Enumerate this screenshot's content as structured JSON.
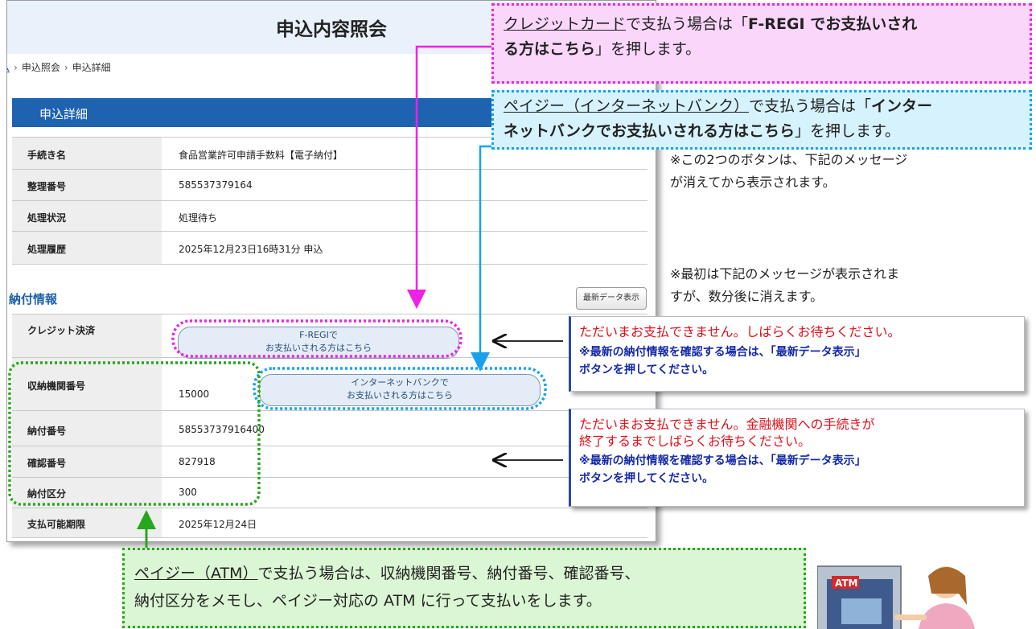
{
  "header": {
    "title": "申込内容照会"
  },
  "breadcrumb": {
    "home": "ム",
    "sep": "›",
    "items": [
      "申込照会",
      "申込詳細"
    ]
  },
  "section": {
    "title": "申込詳細"
  },
  "details": [
    {
      "label": "手続き名",
      "value": "食品営業許可申請手数料【電子納付】"
    },
    {
      "label": "整理番号",
      "value": "585537379164"
    },
    {
      "label": "処理状況",
      "value": "処理待ち"
    },
    {
      "label": "処理履歴",
      "value": "2025年12月23日16時31分 申込"
    }
  ],
  "payment": {
    "title": "納付情報",
    "latest_button": "最新データ表示",
    "credit_label": "クレジット決済",
    "fregi_button_line1": "F-REGIで",
    "fregi_button_line2": "お支払いされる方はこちら",
    "rows": [
      {
        "label": "収納機関番号",
        "value": "15000"
      },
      {
        "label": "納付番号",
        "value": "58553737916400"
      },
      {
        "label": "確認番号",
        "value": "827918"
      },
      {
        "label": "納付区分",
        "value": "300"
      },
      {
        "label": "支払可能期限",
        "value": "2025年12月24日"
      }
    ],
    "bank_button_line1": "インターネットバンクで",
    "bank_button_line2": "お支払いされる方はこちら"
  },
  "callouts": {
    "credit": {
      "u1": "クレジットカード",
      "t1": "で支払う場合は「",
      "b1": "F-REGI でお支払いされ",
      "b2": "る方はこちら",
      "t2": "」を押します。"
    },
    "bank": {
      "u1": "ペイジー（インターネットバンク）",
      "t1": "で支払う場合は「",
      "b1": "インター",
      "b2": "ネットバンクでお支払いされる方はこちら",
      "t2": "」を押します。"
    },
    "atm": {
      "u1": "ペイジー（ATM）",
      "t1": "で支払う場合は、収納機関番号、納付番号、確認番号、",
      "t2": "納付区分をメモし、ペイジー対応の ATM に行って支払いをします。"
    }
  },
  "notes": {
    "note1_line1": "※この2つのボタンは、下記のメッセージ",
    "note1_line2": "が消えてから表示されます。",
    "note2_line1": "※最初は下記のメッセージが表示されま",
    "note2_line2": "すが、数分後に消えます。"
  },
  "messages": {
    "msg1_red": "ただいまお支払できません。しばらくお待ちください。",
    "msg1_blue1": "※最新の納付情報を確認する場合は、「最新データ表示」",
    "msg1_blue2": "ボタンを押してください。",
    "msg2_red1": "ただいまお支払できません。金融機関への手続きが",
    "msg2_red2": "終了するまでしばらくお待ちください。",
    "msg2_blue1": "※最新の納付情報を確認する場合は、「最新データ表示」",
    "msg2_blue2": "ボタンを押してください。"
  },
  "illustration": {
    "atm_text": "ATM"
  },
  "colors": {
    "header_bg": "#e9f1fb",
    "section_bar": "#1e63b0",
    "credit_dotted": "#ee22e6",
    "bank_dotted": "#18a2ee",
    "atm_dotted": "#26a81c",
    "red_text": "#e0101a",
    "blue_text": "#1429a8"
  }
}
